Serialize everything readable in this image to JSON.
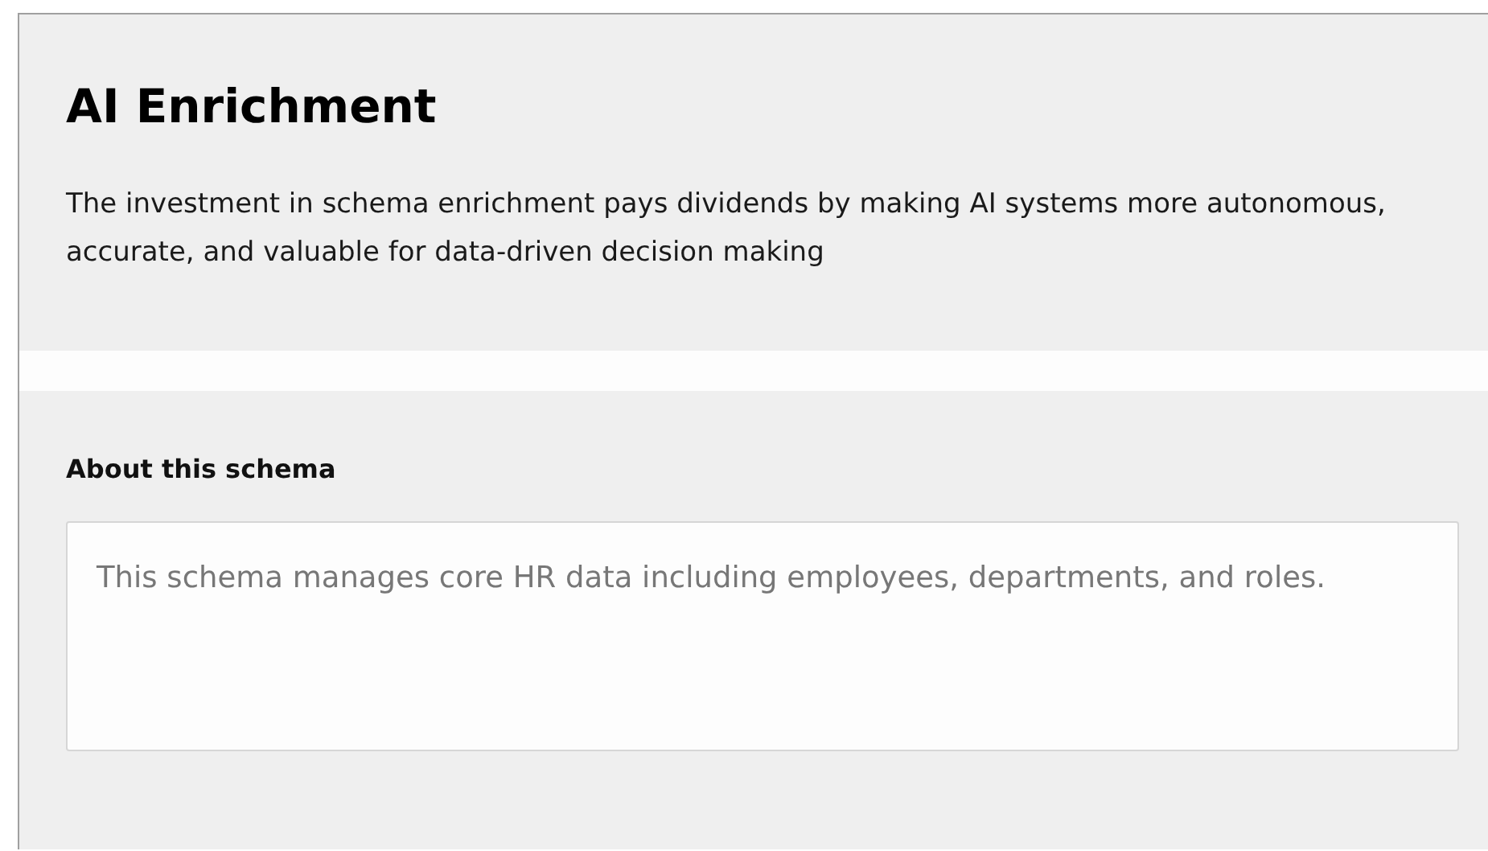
{
  "header": {
    "title": "AI Enrichment",
    "description": "The investment in schema enrichment pays dividends by making AI systems more autonomous, accurate, and valuable for data-driven decision making"
  },
  "about": {
    "label": "About this schema",
    "placeholder": "This schema manages core HR data including employees, departments, and roles."
  }
}
